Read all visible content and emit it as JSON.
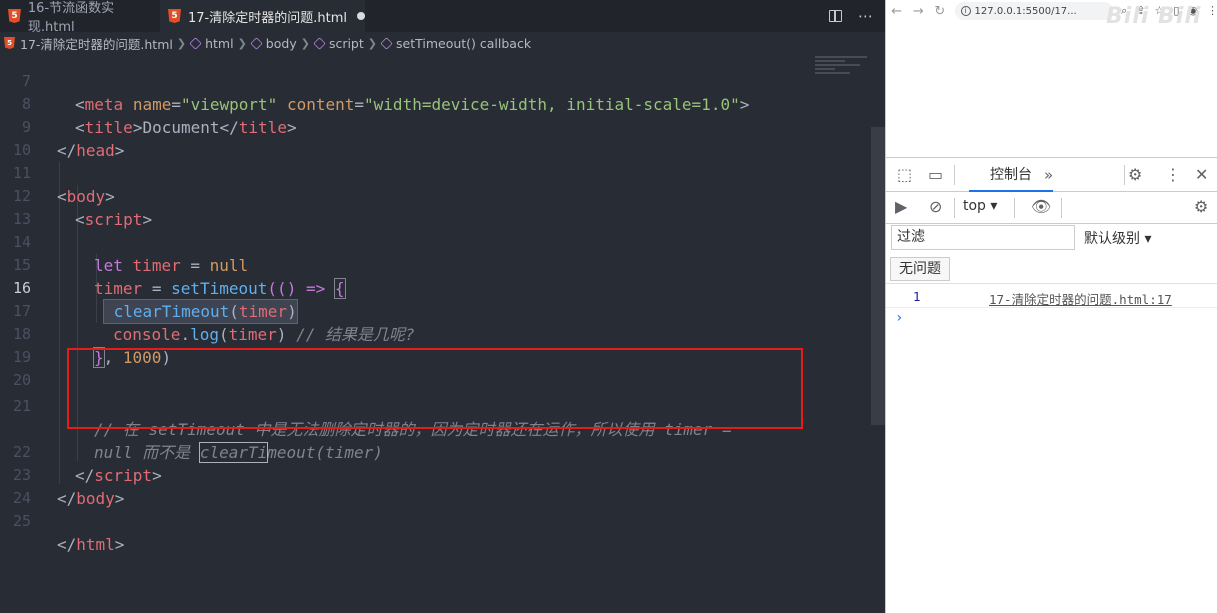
{
  "editor": {
    "tabs": [
      {
        "label": "16-节流函数实现.html",
        "active": false
      },
      {
        "label": "17-清除定时器的问题.html",
        "active": true,
        "dirty": true
      }
    ],
    "breadcrumb": [
      "17-清除定时器的问题.html",
      "html",
      "body",
      "script",
      "setTimeout() callback"
    ],
    "current_line": 16,
    "line_numbers": [
      "7",
      "8",
      "9",
      "10",
      "11",
      "12",
      "13",
      "14",
      "15",
      "16",
      "17",
      "18",
      "19",
      "20",
      "21",
      "",
      "22",
      "23",
      "24",
      "25"
    ],
    "code": {
      "l7": {
        "open": "<",
        "tag": "meta",
        "attr1": "name",
        "eq1": "=",
        "val1": "\"viewport\"",
        "attr2": "content",
        "eq2": "=",
        "val2": "\"width=device-width, initial-scale=1.0\"",
        "close": ">"
      },
      "l8": {
        "open": "<",
        "tag": "title",
        "mid": ">",
        "text": "Document",
        "open2": "</",
        "tag2": "title",
        "close": ">"
      },
      "l9": {
        "open": "</",
        "tag": "head",
        "close": ">"
      },
      "l11": {
        "open": "<",
        "tag": "body",
        "close": ">"
      },
      "l12": {
        "open": "<",
        "tag": "script",
        "close": ">"
      },
      "l14": {
        "kw": "let",
        "name": "timer",
        "eq": "=",
        "val": "null"
      },
      "l15": {
        "name": "timer",
        "eq": "=",
        "fn": "setTimeout",
        "rest": "(() => ",
        "brace": "{"
      },
      "l16": {
        "fn_a": "clearTi",
        "fn_b": "meout",
        "open": "(",
        "arg": "timer",
        "close": ")"
      },
      "l17": {
        "obj": "console",
        "dot": ".",
        "fn": "log",
        "open": "(",
        "arg": "timer",
        "close": ")",
        "comment": "// 结果是几呢?"
      },
      "l18": {
        "brace": "}",
        "rest": ", ",
        "num": "1000",
        "close": ")"
      },
      "l21a": "// 在 setTimeout 中是无法删除定时器的，因为定时器还在运作，所以使用 timer =",
      "l21b_pre": "null 而不是",
      "l21b_box": "clearTi",
      "l21b_post": "meout(timer)",
      "l22": {
        "open": "</",
        "tag": "script",
        "close": ">"
      },
      "l23": {
        "open": "</",
        "tag": "body",
        "close": ">"
      },
      "l25": {
        "open": "</",
        "tag": "html",
        "close": ">"
      }
    }
  },
  "browser": {
    "url": "127.0.0.1:5500/17...",
    "watermark": "Bili Bili",
    "devtools": {
      "tab_console": "控制台",
      "context": "top",
      "filter_placeholder": "过滤",
      "levels": "默认级别",
      "issues": "无问题",
      "log_value": "1",
      "log_source": "17-清除定时器的问题.html:17",
      "prompt": "›"
    }
  }
}
